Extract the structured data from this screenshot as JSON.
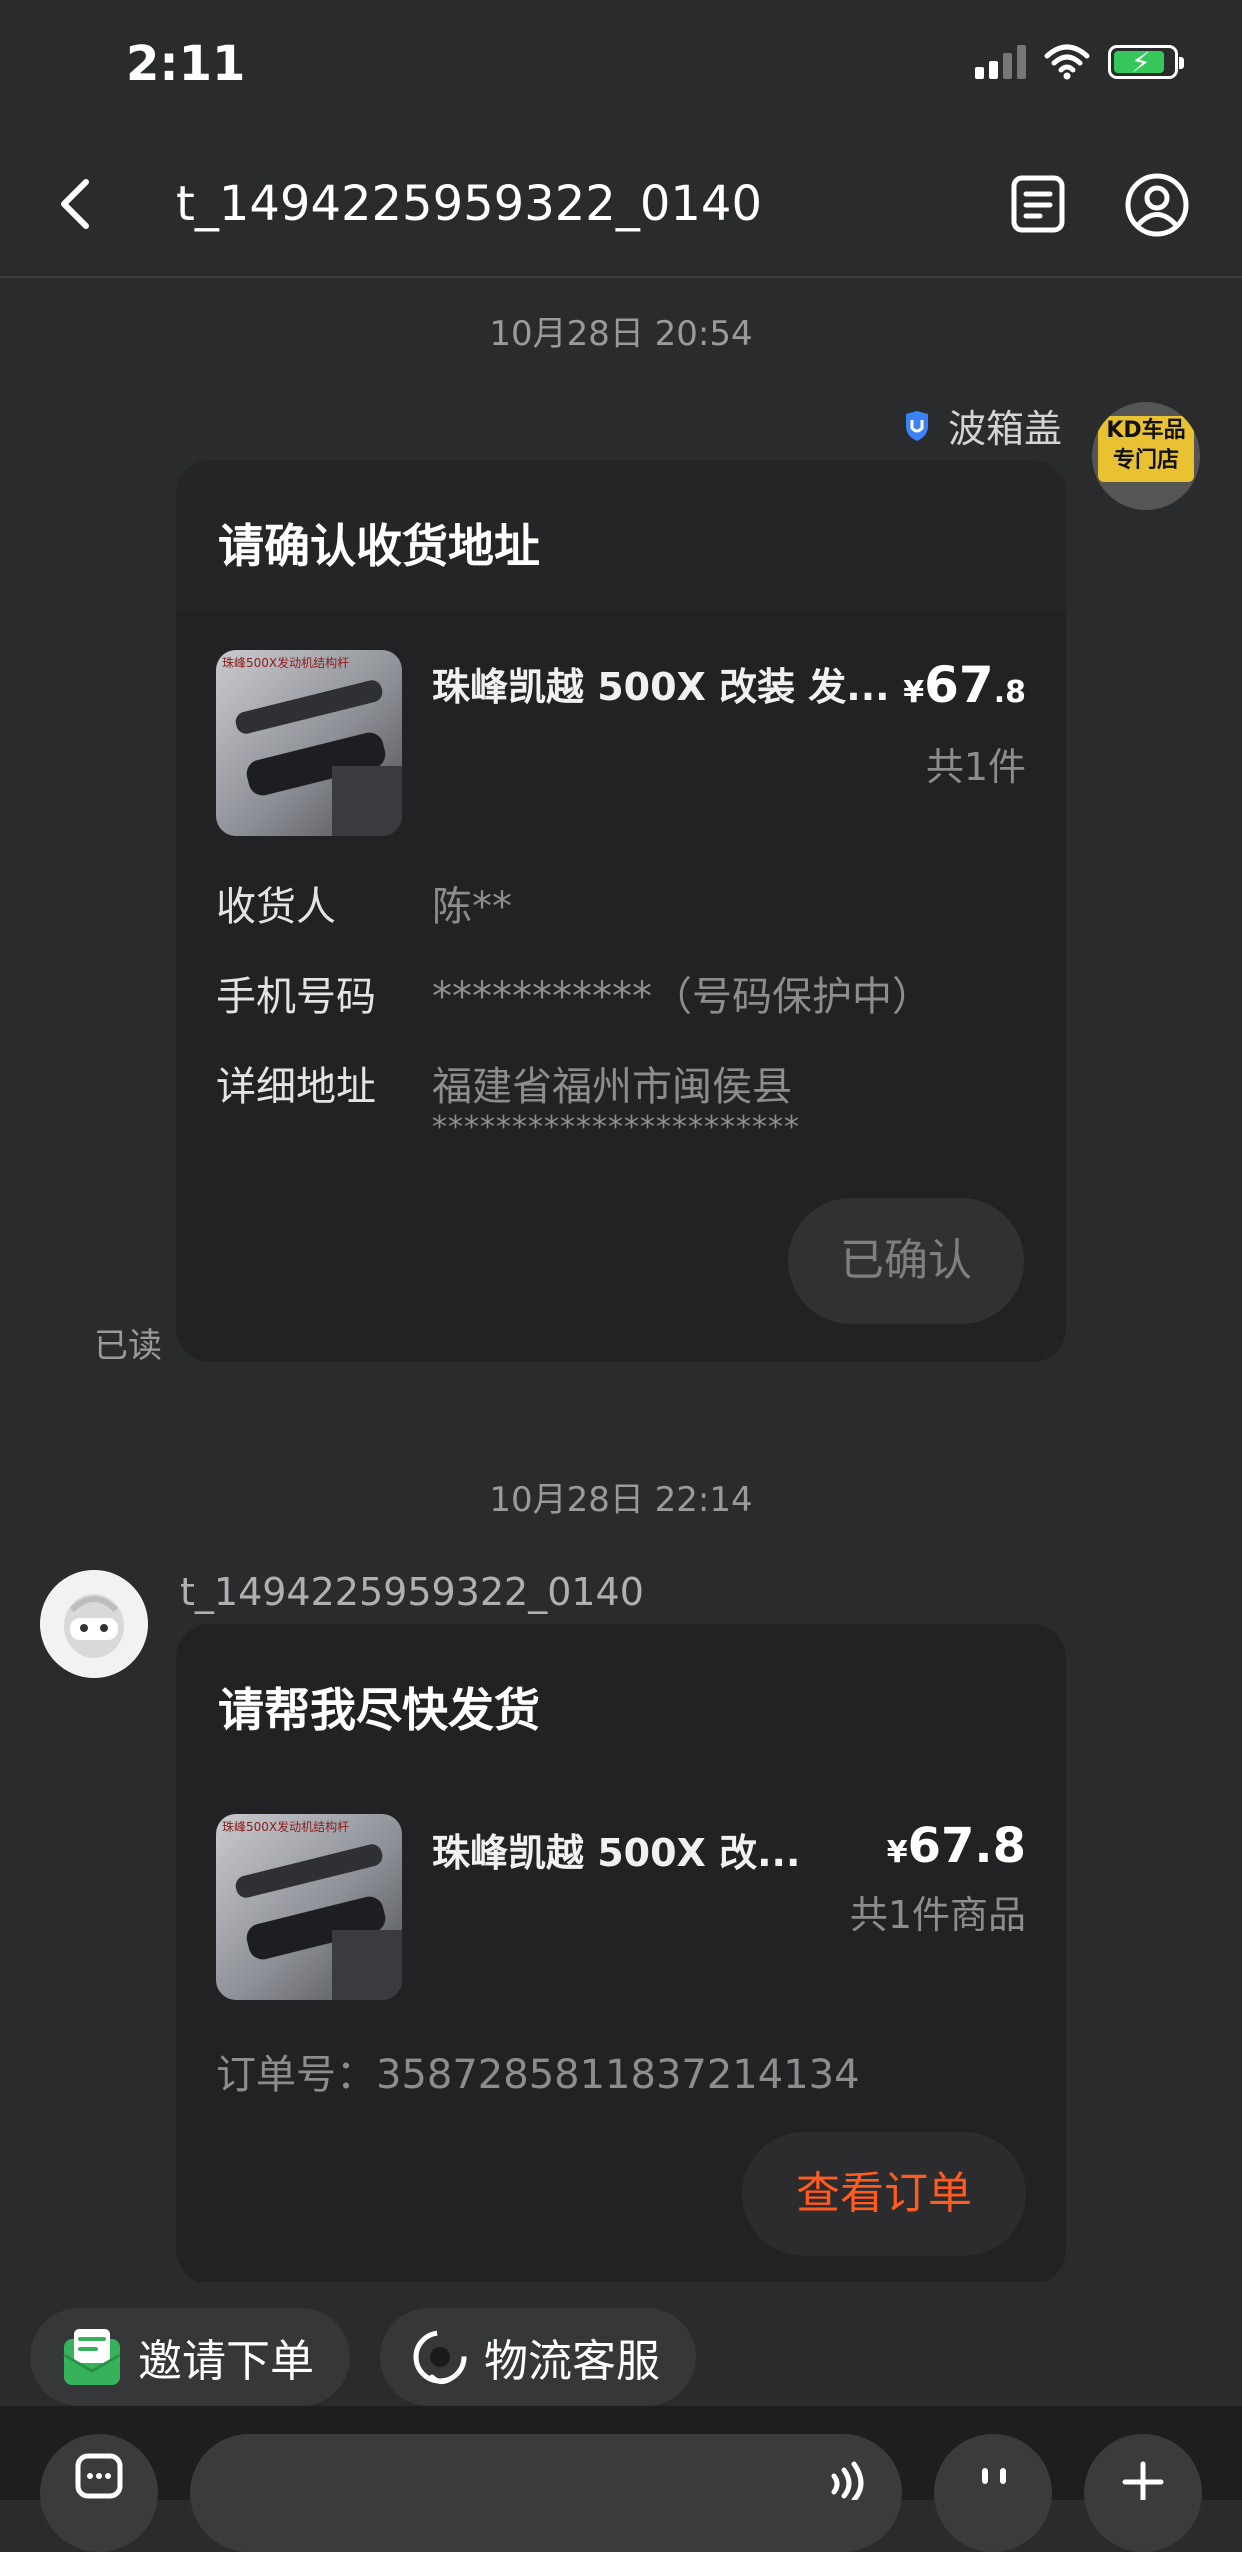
{
  "status_bar": {
    "time": "2:11"
  },
  "header": {
    "title": "t_1494225959322_0140",
    "icons": [
      "chevron-left-icon",
      "order-list-icon",
      "user-profile-icon"
    ]
  },
  "messages": [
    {
      "timestamp": "10月28日 20:54",
      "sender": {
        "name": "波箱盖",
        "avatar_text": "KD车品专门店"
      },
      "card": {
        "title": "请确认收货地址",
        "product": {
          "name": "珠峰凯越 500X 改装 发...",
          "price_symbol": "¥",
          "price_int": "67",
          "price_dec": ".8",
          "quantity": "共1件",
          "thumb_text": "珠峰500X发动机结构杆"
        },
        "fields": [
          {
            "label": "收货人",
            "value": "陈**"
          },
          {
            "label": "手机号码",
            "value": "***********（号码保护中）"
          },
          {
            "label": "详细地址",
            "value": "福建省福州市闽侯县",
            "value2": "***********************"
          }
        ],
        "button": "已确认"
      },
      "read_status": "已读"
    },
    {
      "timestamp": "10月28日 22:14",
      "sender": {
        "name": "t_1494225959322_0140"
      },
      "card": {
        "title": "请帮我尽快发货",
        "product": {
          "name": "珠峰凯越 500X 改...",
          "price_symbol": "¥",
          "price": "67.8",
          "quantity": "共1件商品",
          "thumb_text": "珠峰500X发动机结构杆"
        },
        "order": {
          "label": "订单号：",
          "number": "3587285811837214134"
        },
        "button": "查看订单"
      }
    }
  ],
  "quick_actions": [
    {
      "label": "邀请下单",
      "icon": "invite-order-icon"
    },
    {
      "label": "物流客服",
      "icon": "logistics-service-icon"
    }
  ],
  "input_bar": {
    "icons": [
      "chat-menu-icon",
      "voice-icon",
      "emoji-icon",
      "plus-icon"
    ]
  },
  "colors": {
    "background": "#2a2b2d",
    "card": "#222224",
    "accent": "#ff5a1f",
    "battery": "#36c75a",
    "verified": "#3b82f6"
  }
}
